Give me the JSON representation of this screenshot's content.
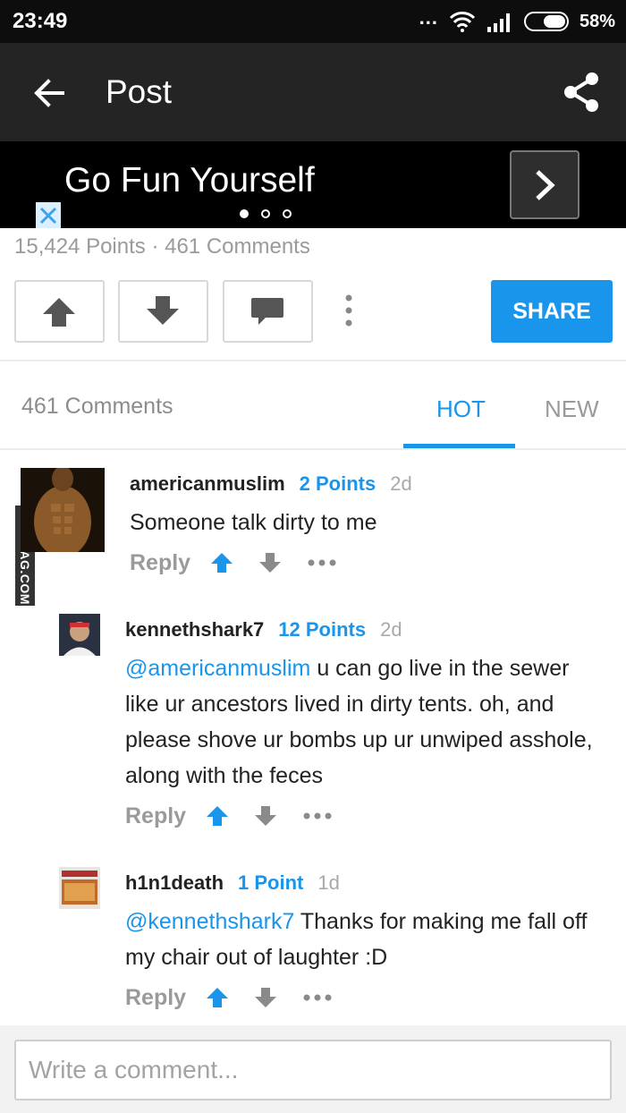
{
  "status_bar": {
    "time": "23:49",
    "dots": "...",
    "battery": "58%",
    "battery_level": 0.58
  },
  "app_bar": {
    "title": "Post"
  },
  "ad": {
    "text": "Go Fun Yourself"
  },
  "post": {
    "stats": "15,424 Points · 461 Comments",
    "share_label": "SHARE"
  },
  "comments_header": {
    "count": "461 Comments",
    "tabs": [
      "HOT",
      "NEW"
    ],
    "active_tab": "HOT"
  },
  "watermark": "VIA 9GAG.COM",
  "comments": [
    {
      "username": "americanmuslim",
      "points": "2 Points",
      "age": "2d",
      "mention": "",
      "text": "Someone talk dirty to me",
      "reply": "Reply"
    },
    {
      "username": "kennethshark7",
      "points": "12 Points",
      "age": "2d",
      "mention": "@americanmuslim",
      "text": " u can go live in the sewer like ur ancestors lived in dirty tents. oh, and please shove ur bombs up ur unwiped asshole, along with the feces",
      "reply": "Reply"
    },
    {
      "username": "h1n1death",
      "points": "1 Point",
      "age": "1d",
      "mention": "@kennethshark7",
      "text": " Thanks for making me fall off my chair out of laughter :D",
      "reply": "Reply"
    }
  ],
  "comment_input": {
    "placeholder": "Write a comment..."
  },
  "colors": {
    "accent": "#1a95ec",
    "app_bar": "#242424",
    "status_bar": "#0d0d0d"
  },
  "icons": [
    "back-arrow-icon",
    "share-icon",
    "chevron-right-icon",
    "close-icon",
    "upvote-icon",
    "downvote-icon",
    "comment-icon",
    "more-vert-icon",
    "more-horiz-icon",
    "wifi-icon",
    "signal-icon",
    "battery-icon"
  ]
}
